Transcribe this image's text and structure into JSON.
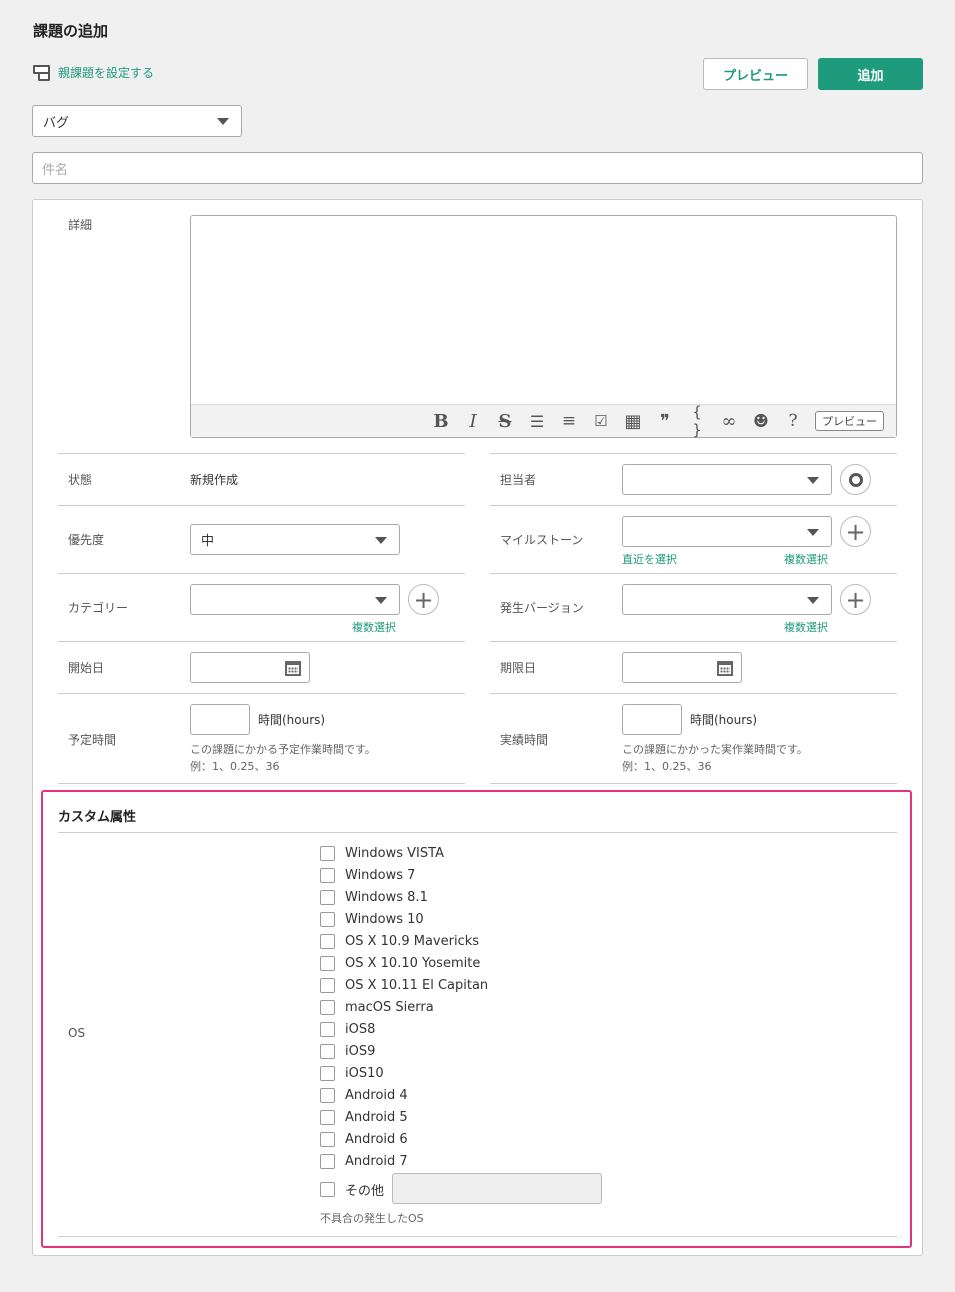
{
  "page": {
    "title": "課題の追加",
    "parent_link": "親課題を設定する"
  },
  "header": {
    "preview_label": "プレビュー",
    "add_label": "追加"
  },
  "issue_type": {
    "value": "バグ"
  },
  "subject": {
    "placeholder": "件名"
  },
  "detail": {
    "label": "詳細",
    "toolbar": {
      "bold": "B",
      "italic": "I",
      "strike": "S",
      "bullet": "☰",
      "numbered": "≡",
      "checklist": "☑",
      "table": "▦",
      "quote": "❞",
      "code": "{ }",
      "link": "∞",
      "emoji": "☻",
      "help": "?",
      "preview": "プレビュー"
    }
  },
  "fields": {
    "status": {
      "label": "状態",
      "value": "新規作成"
    },
    "assignee": {
      "label": "担当者",
      "value": ""
    },
    "priority": {
      "label": "優先度",
      "value": "中"
    },
    "milestone": {
      "label": "マイルストーン",
      "recent_link": "直近を選択",
      "multi_link": "複数選択"
    },
    "category": {
      "label": "カテゴリー",
      "multi_link": "複数選択"
    },
    "version": {
      "label": "発生バージョン",
      "multi_link": "複数選択"
    },
    "start_date": {
      "label": "開始日"
    },
    "due_date": {
      "label": "期限日"
    },
    "estimated": {
      "label": "予定時間",
      "unit": "時間(hours)",
      "hint1": "この課題にかかる予定作業時間です。",
      "hint2": "例：1、0.25、36"
    },
    "actual": {
      "label": "実績時間",
      "unit": "時間(hours)",
      "hint1": "この課題にかかった実作業時間です。",
      "hint2": "例：1、0.25、36"
    }
  },
  "custom": {
    "title": "カスタム属性",
    "os_label": "OS",
    "options": [
      "Windows VISTA",
      "Windows 7",
      "Windows 8.1",
      "Windows 10",
      "OS X 10.9 Mavericks",
      "OS X 10.10 Yosemite",
      "OS X 10.11 El Capitan",
      "macOS Sierra",
      "iOS8",
      "iOS9",
      "iOS10",
      "Android 4",
      "Android 5",
      "Android 6",
      "Android 7"
    ],
    "other_label": "その他",
    "help_text": "不具合の発生したOS"
  },
  "colors": {
    "accent": "#1e9a7d",
    "highlight": "#e2337f"
  }
}
